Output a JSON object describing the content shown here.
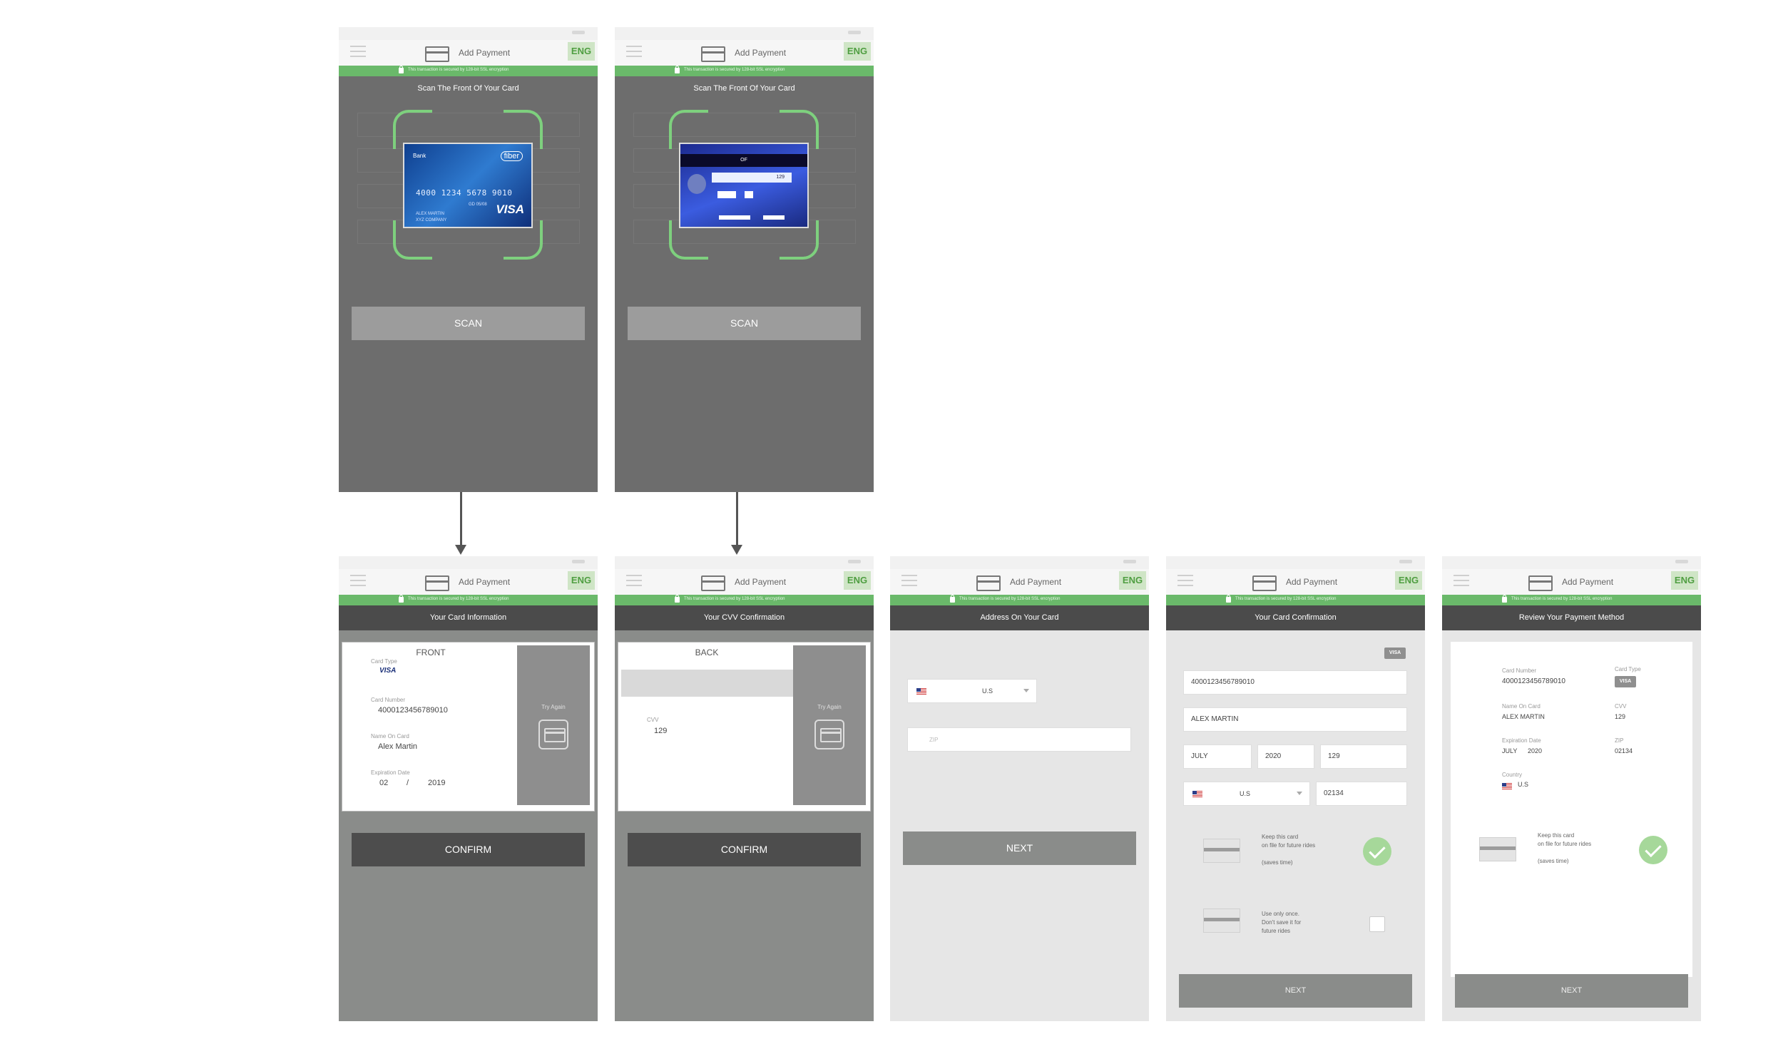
{
  "common": {
    "app_title": "Add Payment",
    "lang_button": "ENG",
    "secure_note": "This transaction is secured by 128-bit SSL encryption"
  },
  "scan_front": {
    "header": "Scan The Front Of Your Card",
    "card_number": "4000 1234 5678 9010",
    "card_holder": "ALEX MARTIN",
    "card_holder_sub": "XYZ COMPANY",
    "card_sub": "GD 05/08",
    "card_brand": "VISA",
    "card_bank": "Bank",
    "card_tag": "fiber",
    "button": "SCAN"
  },
  "scan_back": {
    "header": "Scan The Front Of Your Card",
    "card_strip": "OF",
    "cvv_on_card": "129",
    "button": "SCAN"
  },
  "card_info": {
    "header": "Your Card Information",
    "side": "FRONT",
    "card_type_label": "Card Type",
    "card_type": "VISA",
    "card_number_label": "Card Number",
    "card_number": "4000123456789010",
    "name_label": "Name On Card",
    "name": "Alex Martin",
    "expiry_label": "Expiration Date",
    "exp_month": "02",
    "exp_sep": "/",
    "exp_year": "2019",
    "try_again": "Try Again",
    "button": "CONFIRM"
  },
  "cvv_confirm": {
    "header": "Your CVV Confirmation",
    "side": "BACK",
    "cvv_label": "CVV",
    "cvv": "129",
    "try_again": "Try Again",
    "button": "CONFIRM"
  },
  "address": {
    "header": "Address On Your Card",
    "country": "U.S",
    "zip_placeholder": "ZIP",
    "button": "NEXT"
  },
  "card_confirmation": {
    "header": "Your Card Confirmation",
    "badge": "VISA",
    "card_number": "4000123456789010",
    "name": "ALEX MARTIN",
    "month": "JULY",
    "year": "2020",
    "cvv": "129",
    "country": "U.S",
    "zip": "02134",
    "keep_text": "Keep this card\non file for future rides\n\n(saves time)",
    "once_text": "Use only once.\nDon't save it for\nfuture rides",
    "button": "NEXT"
  },
  "review": {
    "header": "Review Your Payment Method",
    "card_number_label": "Card Number",
    "card_number": "4000123456789010",
    "card_type_label": "Card Type",
    "card_type": "VISA",
    "name_label": "Name On Card",
    "name": "ALEX MARTIN",
    "cvv_label": "CVV",
    "cvv": "129",
    "expiry_label": "Expiration Date",
    "month": "JULY",
    "year": "2020",
    "zip_label": "ZIP",
    "zip": "02134",
    "country_label": "Country",
    "country": "U.S",
    "keep_text": "Keep this card\non file for future rides\n\n(saves time)",
    "button": "NEXT"
  },
  "colors": {
    "accent_green": "#6ab96a",
    "dark_header": "#4b4b4b",
    "lang_bg": "#cfe5c6"
  }
}
